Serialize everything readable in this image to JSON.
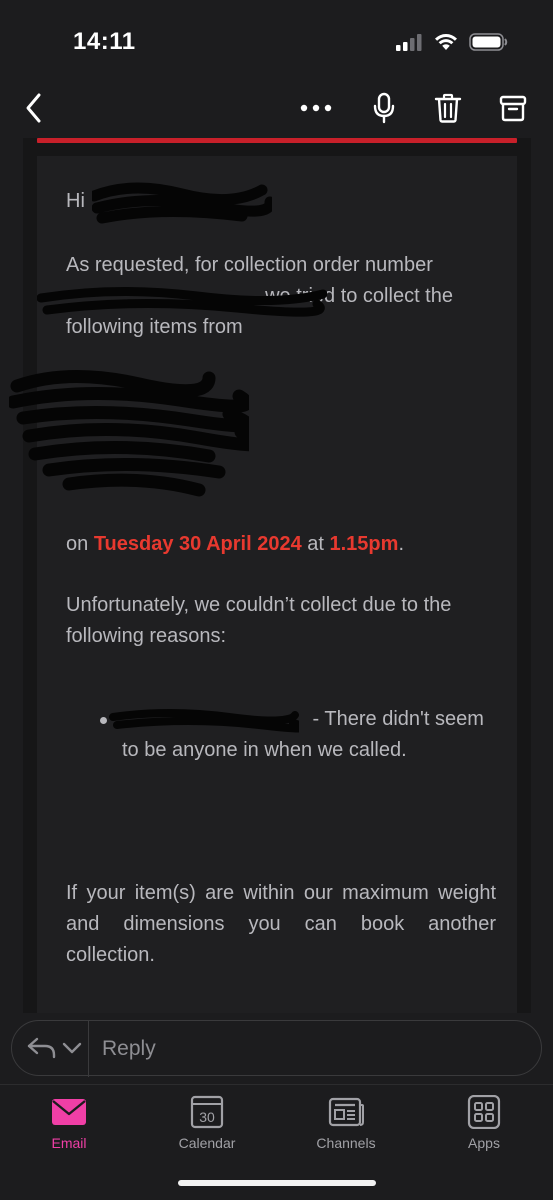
{
  "status_bar": {
    "time": "14:11"
  },
  "nav": {
    "back_icon": "chevron-left-icon",
    "more_icon": "ellipsis-icon",
    "mic_icon": "microphone-icon",
    "delete_icon": "trash-icon",
    "archive_icon": "archive-icon"
  },
  "email": {
    "greeting": "Hi",
    "intro_1": "As requested, for collection order number",
    "intro_2": ", we tried to collect the",
    "intro_3": "following items from",
    "date_prefix": "on ",
    "date": "Tuesday 30 April 2024",
    "time_prefix": " at ",
    "time": "1.15pm",
    "time_suffix": ".",
    "reason_intro": "Unfortunately, we couldn’t collect due to the following reasons:",
    "reason_item": " - There didn't seem to be anyone in when we called.",
    "footer_text": "If your item(s) are within our maximum weight and dimensions you can book another collection."
  },
  "reply_bar": {
    "placeholder": "Reply",
    "reply_icon": "reply-icon",
    "chevron_icon": "chevron-down-icon"
  },
  "tabs": [
    {
      "label": "Email",
      "icon": "envelope-icon",
      "active": true
    },
    {
      "label": "Calendar",
      "icon": "calendar-icon",
      "badge": "30"
    },
    {
      "label": "Channels",
      "icon": "newspaper-icon"
    },
    {
      "label": "Apps",
      "icon": "apps-grid-icon"
    }
  ],
  "colors": {
    "accent_red": "#e8392f",
    "rule_red": "#c8202a",
    "active_tab": "#f03fa6"
  }
}
